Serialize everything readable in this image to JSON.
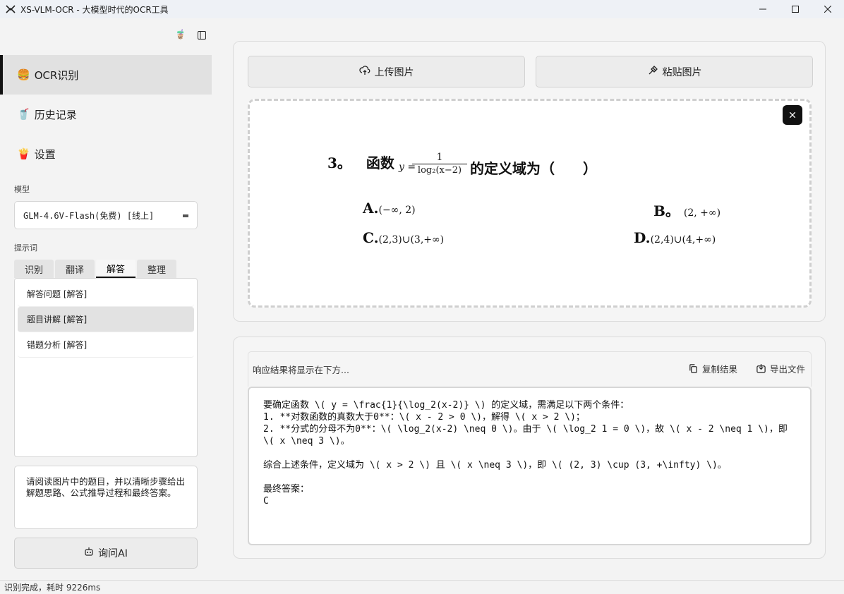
{
  "window": {
    "title": "XS-VLM-OCR - 大模型时代的OCR工具"
  },
  "sidebar": {
    "nav": [
      {
        "icon": "🍔",
        "label": "OCR识别",
        "active": true
      },
      {
        "icon": "🥤",
        "label": "历史记录",
        "active": false
      },
      {
        "icon": "🍟",
        "label": "设置",
        "active": false
      }
    ],
    "model_label": "模型",
    "model_value": "GLM-4.6V-Flash(免费) [线上]",
    "prompt_label": "提示词",
    "tabs": [
      "识别",
      "翻译",
      "解答",
      "整理"
    ],
    "active_tab": "解答",
    "prompt_items": [
      "解答问题 [解答]",
      "题目讲解 [解答]",
      "错题分析 [解答]"
    ],
    "prompt_text": "请阅读图片中的题目，并以清晰步骤给出解题思路、公式推导过程和最终答案。",
    "ask_button": "询问AI"
  },
  "main": {
    "upload_button": "上传图片",
    "paste_button": "粘贴图片",
    "image": {
      "question_number": "3。",
      "question_prefix": "函数",
      "y_eq": "y =",
      "frac_num": "1",
      "frac_den": "log₂(x−2)",
      "question_suffix": "的定义域为（　　）",
      "options": [
        {
          "letter": "A.",
          "value": "(−∞, 2)"
        },
        {
          "letter": "B。",
          "value": "(2, +∞)"
        },
        {
          "letter": "C.",
          "value": "(2,3)∪(3,+∞)"
        },
        {
          "letter": "D.",
          "value": "(2,4)∪(4,+∞)"
        }
      ]
    },
    "result": {
      "placeholder": "响应结果将显示在下方...",
      "copy_button": "复制结果",
      "export_button": "导出文件",
      "text": "要确定函数 \\( y = \\frac{1}{\\log_2(x-2)} \\) 的定义域，需满足以下两个条件：\n1. **对数函数的真数大于0**：\\( x - 2 > 0 \\)，解得 \\( x > 2 \\)；\n2. **分式的分母不为0**：\\( \\log_2(x-2) \\neq 0 \\)。由于 \\( \\log_2 1 = 0 \\)，故 \\( x - 2 \\neq 1 \\)，即 \\( x \\neq 3 \\)。\n\n综合上述条件，定义域为 \\( x > 2 \\) 且 \\( x \\neq 3 \\)，即 \\( (2, 3) \\cup (3, +\\infty) \\)。\n\n最终答案：\nC"
    }
  },
  "status": {
    "text": "识别完成，耗时 9226ms"
  }
}
